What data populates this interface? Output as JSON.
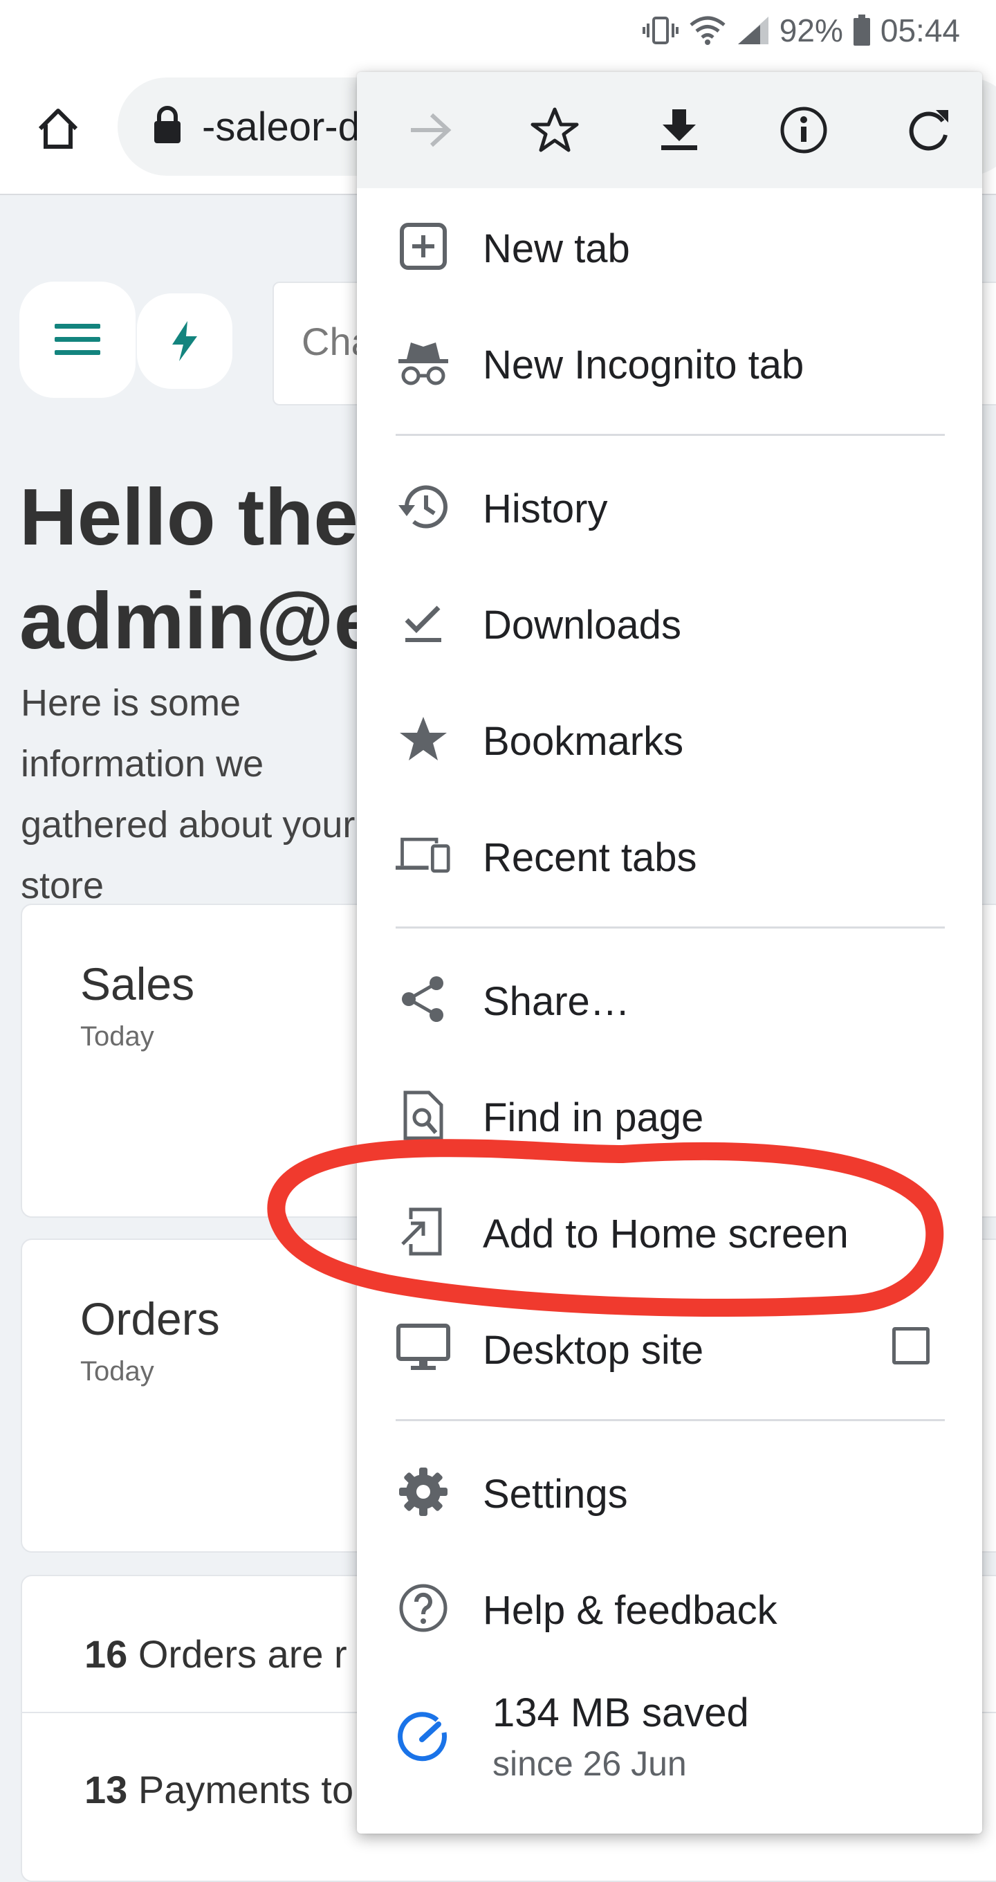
{
  "status_bar": {
    "battery": "92%",
    "time": "05:44"
  },
  "browser": {
    "url": "-saleor-demo.herokuapp.com"
  },
  "page": {
    "search_placeholder": "Cha",
    "greeting_line1": "Hello there,",
    "greeting_line2": "admin@example.com",
    "subtitle": "Here is some information we gathered about your store",
    "cards": [
      {
        "title": "Sales",
        "sub": "Today"
      },
      {
        "title": "Orders",
        "sub": "Today"
      }
    ],
    "notifications": [
      {
        "count": "16",
        "text": "Orders are r"
      },
      {
        "count": "13",
        "text": "Payments to"
      }
    ]
  },
  "menu": {
    "items": [
      {
        "label": "New tab",
        "icon": "new-tab-icon"
      },
      {
        "label": "New Incognito tab",
        "icon": "incognito-icon"
      },
      {
        "label": "History",
        "icon": "history-icon"
      },
      {
        "label": "Downloads",
        "icon": "downloads-check-icon"
      },
      {
        "label": "Bookmarks",
        "icon": "star-filled-icon"
      },
      {
        "label": "Recent tabs",
        "icon": "devices-icon"
      },
      {
        "label": "Share…",
        "icon": "share-icon"
      },
      {
        "label": "Find in page",
        "icon": "find-in-page-icon"
      },
      {
        "label": "Add to Home screen",
        "icon": "add-to-home-icon"
      },
      {
        "label": "Desktop site",
        "icon": "desktop-icon",
        "checked": false
      },
      {
        "label": "Settings",
        "icon": "settings-gear-icon"
      },
      {
        "label": "Help & feedback",
        "icon": "help-icon"
      }
    ],
    "data_saver": {
      "amount": "134 MB saved",
      "since": "since 26 Jun"
    }
  },
  "colors": {
    "accent_teal": "#13847e",
    "annotation_red": "#f03a2e",
    "data_saver_blue": "#1a73e8"
  }
}
